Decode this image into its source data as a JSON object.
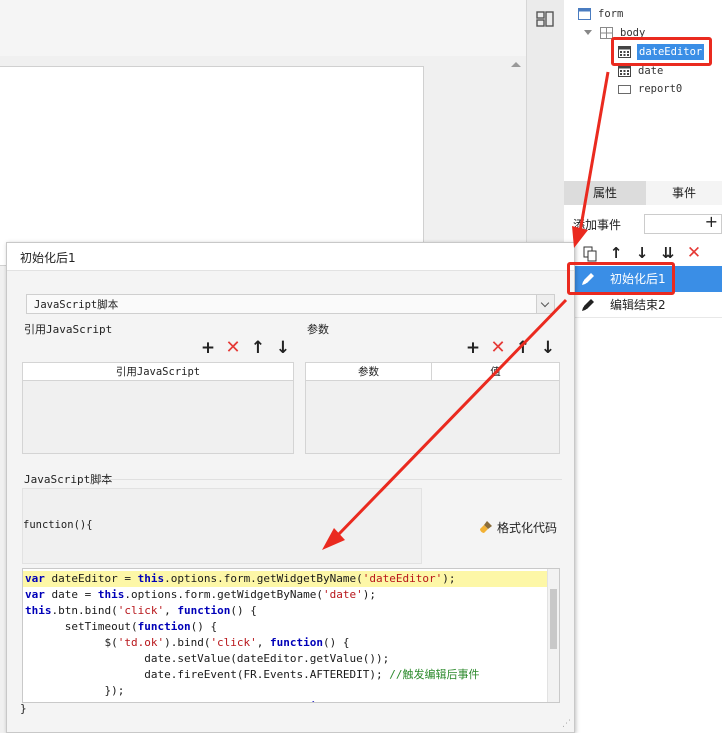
{
  "tree": {
    "form": "form",
    "body": "body",
    "dateEditor": "dateEditor",
    "date": "date",
    "report0": "report0"
  },
  "right_panel": {
    "tab_props": "属性",
    "tab_events": "事件",
    "add_event_label": "添加事件",
    "add_event_plus": "+",
    "events": [
      {
        "label": "初始化后1"
      },
      {
        "label": "编辑结束2"
      }
    ]
  },
  "dialog": {
    "title": "初始化后1",
    "type_select": "JavaScript脚本",
    "ref_js_label": "引用JavaScript",
    "params_label": "参数",
    "ref_js_column": "引用JavaScript",
    "params_columns": [
      "参数",
      "值"
    ],
    "js_section_label": "JavaScript脚本",
    "function_head": "function(){",
    "format_button": "格式化代码",
    "closing_brace": "}",
    "code": [
      "var dateEditor = this.options.form.getWidgetByName('dateEditor');",
      "var date = this.options.form.getWidgetByName('date');",
      "this.btn.bind('click', function() {",
      "      setTimeout(function() {",
      "            $('td.ok').bind('click', function() {",
      "                  date.setValue(dateEditor.getValue());",
      "                  date.fireEvent(FR.Events.AFTEREDIT); //触发编辑后事件",
      "            });",
      "            $('td.now').bind('click', function() {"
    ]
  },
  "colors": {
    "accent": "#3a8ee6",
    "annotation_red": "#ea2a1f",
    "delete_red": "#e53935",
    "highlight_line": "#fdf7a7"
  }
}
